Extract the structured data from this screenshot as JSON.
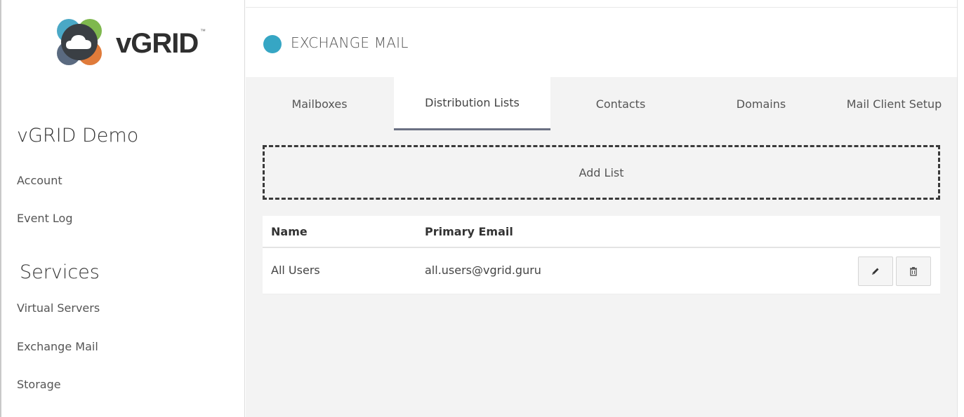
{
  "brand": {
    "name": "vGRID",
    "trademark": "™"
  },
  "sidebar": {
    "account_heading": "vGRID Demo",
    "account_links": [
      {
        "label": "Account"
      },
      {
        "label": "Event Log"
      }
    ],
    "services_heading": "Services",
    "service_links": [
      {
        "label": "Virtual Servers"
      },
      {
        "label": "Exchange Mail"
      },
      {
        "label": "Storage"
      }
    ]
  },
  "module": {
    "title": "EXCHANGE MAIL",
    "accent_color": "#36a6c4"
  },
  "tabs": [
    {
      "label": "Mailboxes",
      "active": false
    },
    {
      "label": "Distribution Lists",
      "active": true
    },
    {
      "label": "Contacts",
      "active": false
    },
    {
      "label": "Domains",
      "active": false
    },
    {
      "label": "Mail Client Setup",
      "active": false
    }
  ],
  "add_list": {
    "label": "Add List"
  },
  "table": {
    "columns": [
      "Name",
      "Primary Email"
    ],
    "rows": [
      {
        "name": "All Users",
        "email": "all.users@vgrid.guru",
        "actions": [
          "pencil-icon",
          "trash-icon"
        ]
      }
    ]
  }
}
